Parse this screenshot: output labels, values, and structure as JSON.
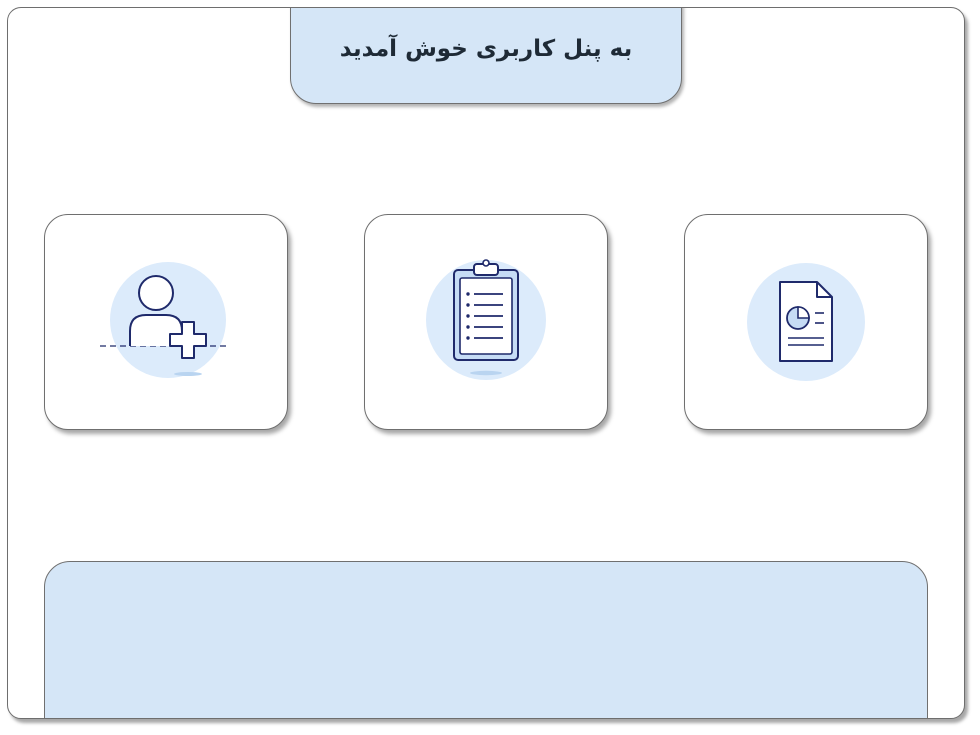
{
  "header": {
    "welcome_text": "به پنل کاربری خوش آمدید"
  },
  "cards": [
    {
      "icon": "add-user-icon"
    },
    {
      "icon": "clipboard-list-icon"
    },
    {
      "icon": "report-document-icon"
    }
  ],
  "colors": {
    "panel_bg": "#d5e6f7",
    "icon_circle": "#dcebfb",
    "icon_stroke": "#1f2a6b",
    "frame_border": "#6e6e6e"
  }
}
